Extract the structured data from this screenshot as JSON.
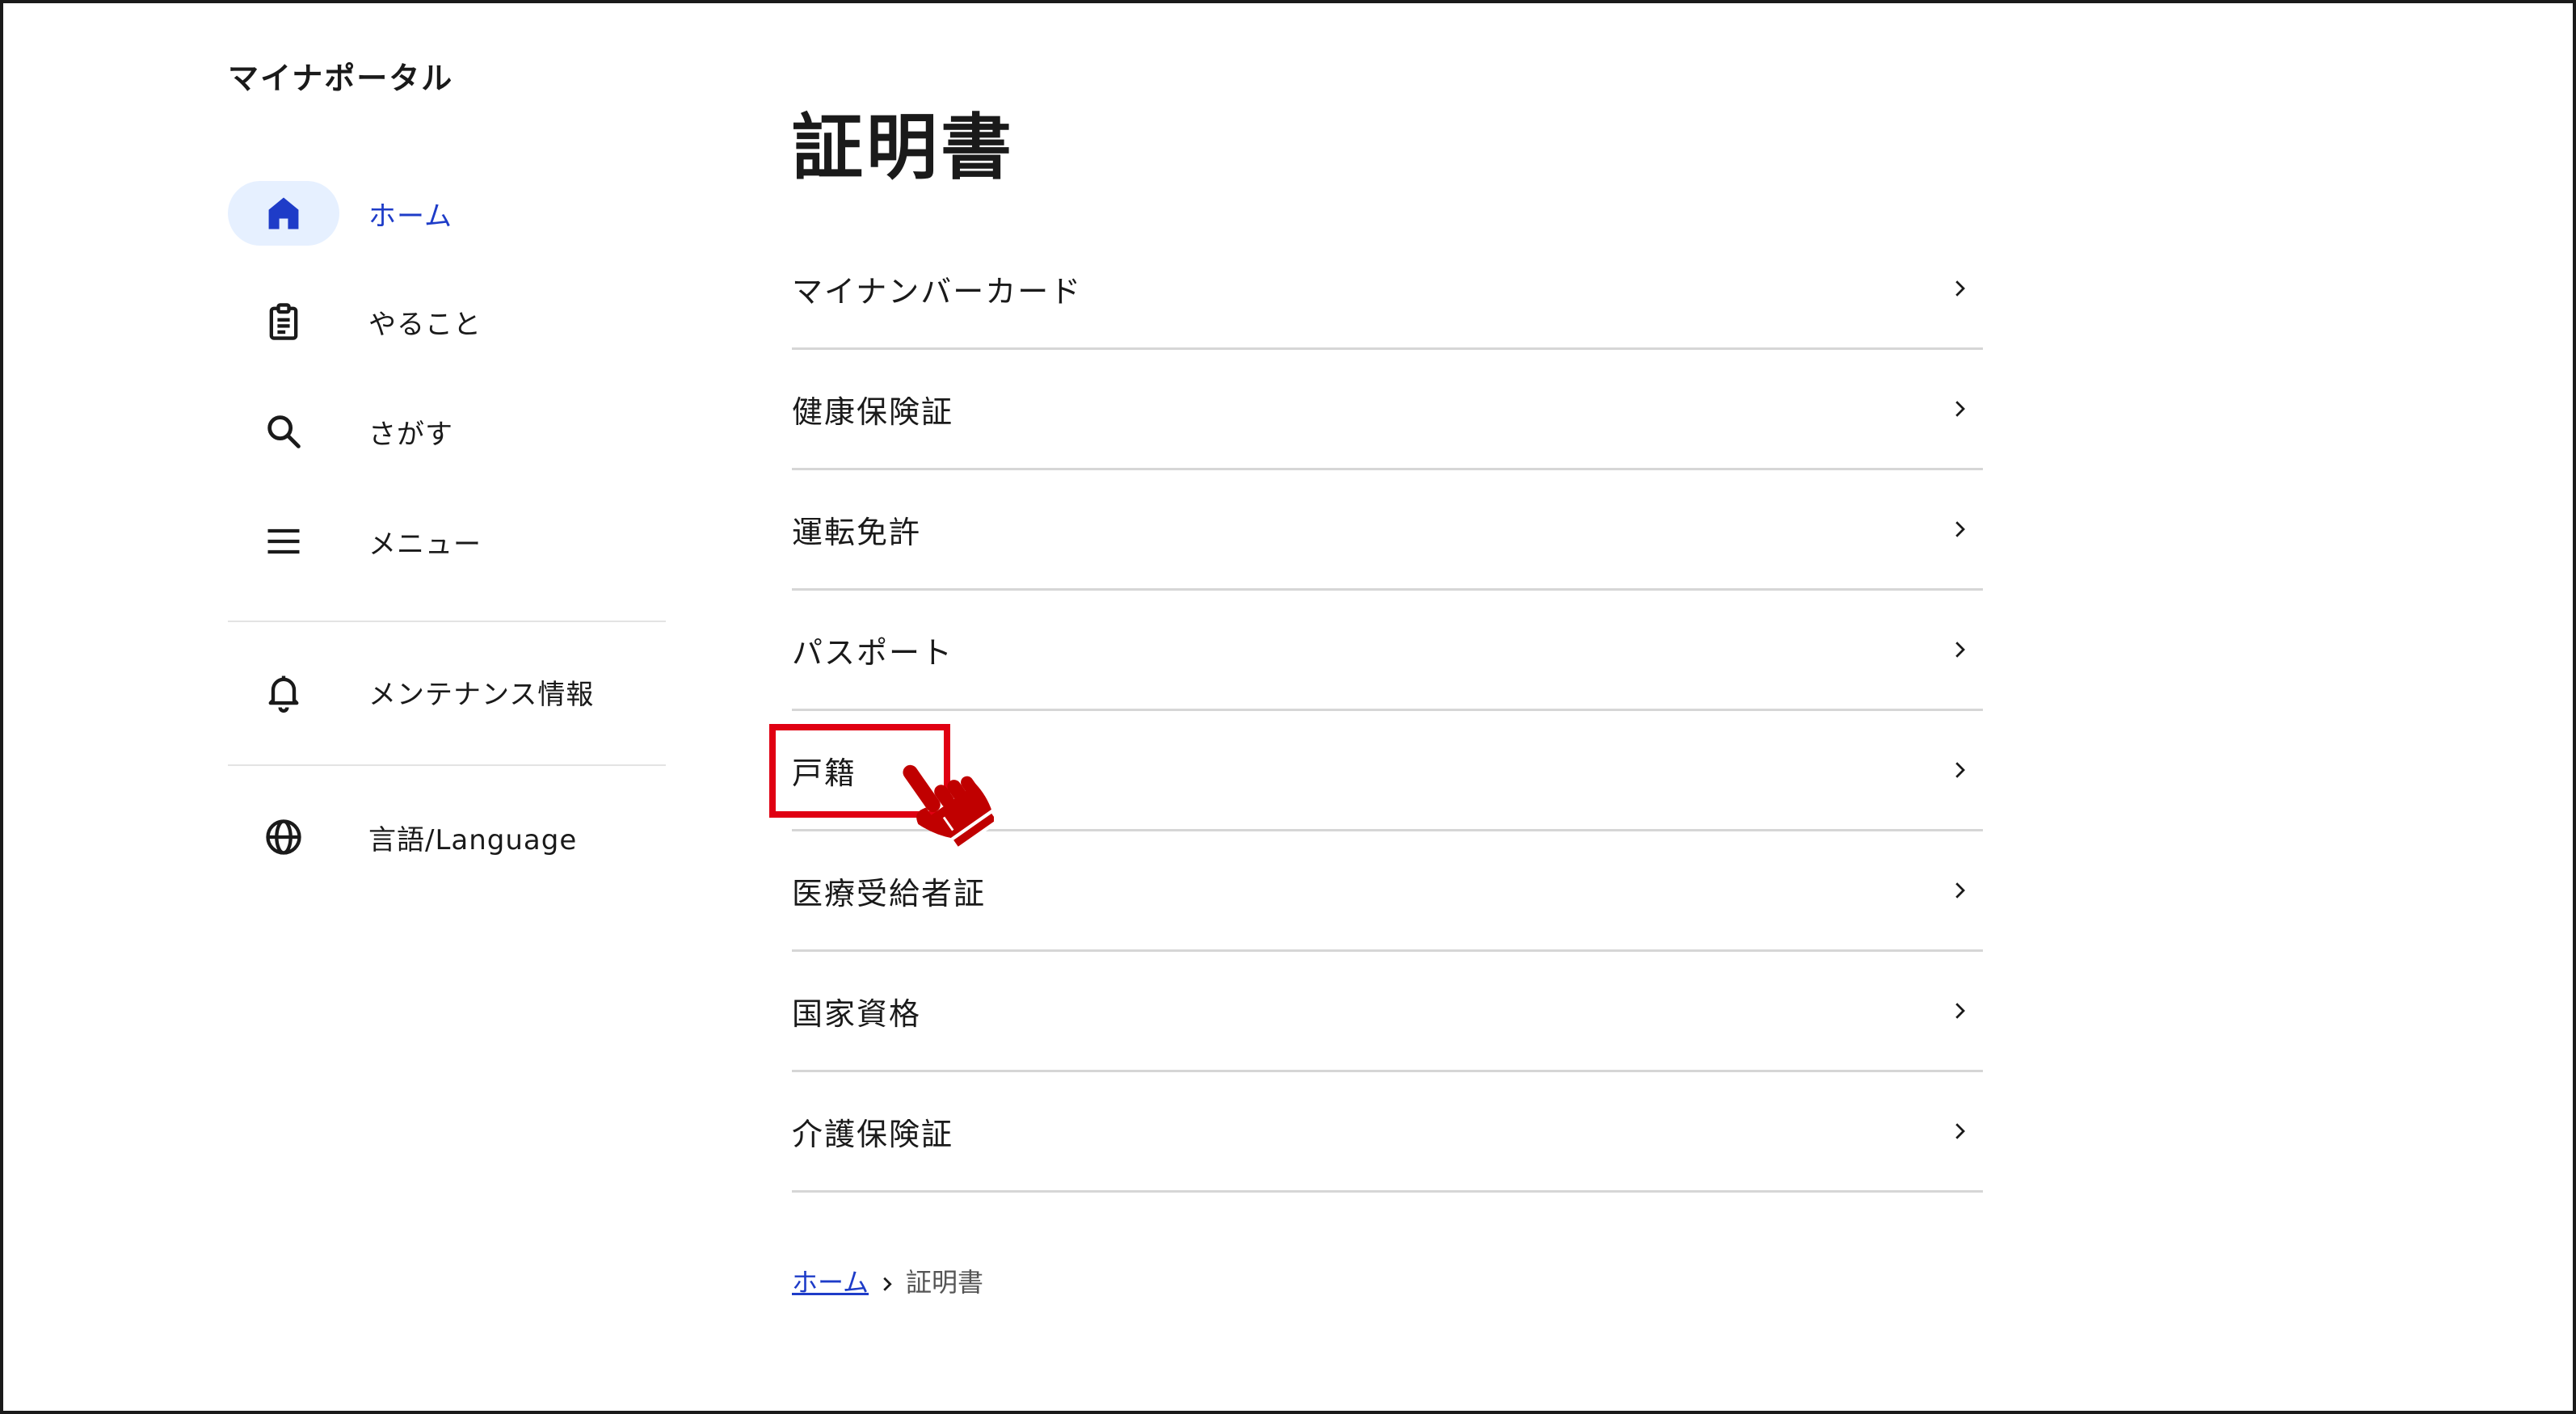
{
  "app": {
    "title": "マイナポータル"
  },
  "sidebar": {
    "items": [
      {
        "label": "ホーム",
        "icon": "home-icon",
        "active": true
      },
      {
        "label": "やること",
        "icon": "clipboard-icon",
        "active": false
      },
      {
        "label": "さがす",
        "icon": "search-icon",
        "active": false
      },
      {
        "label": "メニュー",
        "icon": "menu-icon",
        "active": false
      }
    ],
    "secondary_items": [
      {
        "label": "メンテナンス情報",
        "icon": "bell-icon"
      },
      {
        "label": "言語/Language",
        "icon": "globe-icon"
      }
    ]
  },
  "main": {
    "title": "証明書",
    "certificates": [
      {
        "label": "マイナンバーカード"
      },
      {
        "label": "健康保険証"
      },
      {
        "label": "運転免許"
      },
      {
        "label": "パスポート"
      },
      {
        "label": "戸籍",
        "highlighted": true
      },
      {
        "label": "医療受給者証"
      },
      {
        "label": "国家資格"
      },
      {
        "label": "介護保険証"
      }
    ]
  },
  "breadcrumb": {
    "home": "ホーム",
    "current": "証明書"
  },
  "colors": {
    "accent": "#1e3cc8",
    "active_bg": "#e6f0ff",
    "highlight": "#e00012",
    "pointer": "#c00000",
    "divider": "#d6d6d6"
  }
}
